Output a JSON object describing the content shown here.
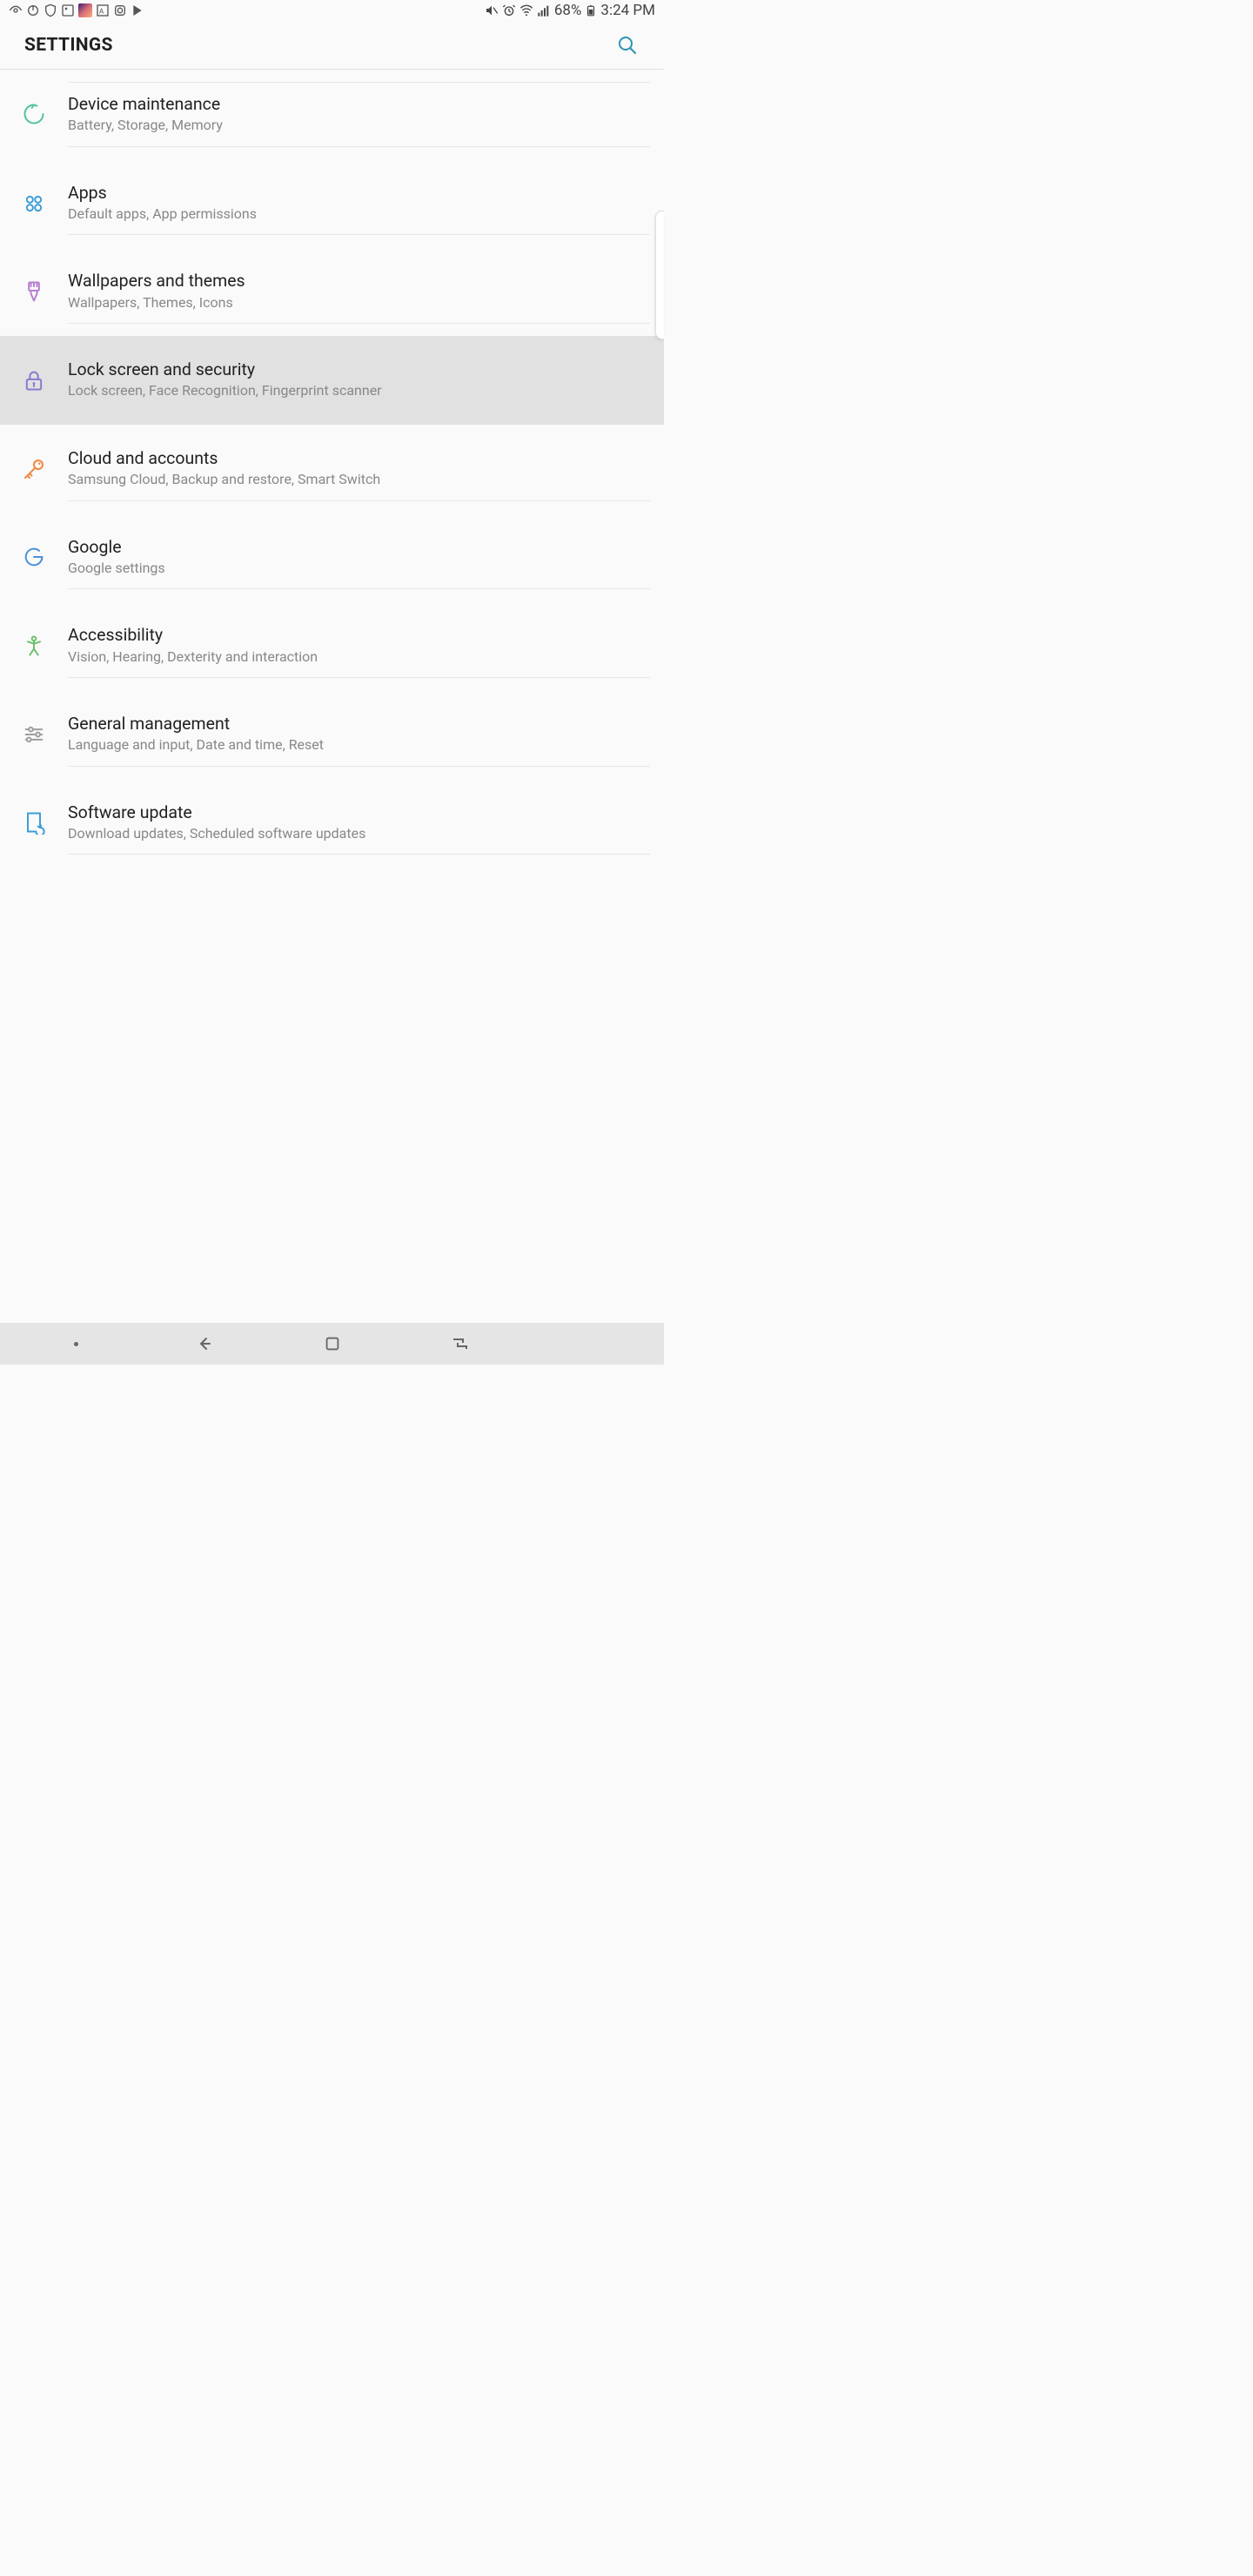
{
  "status": {
    "battery_pct": "68%",
    "time": "3:24 PM"
  },
  "header": {
    "title": "SETTINGS"
  },
  "items": [
    {
      "id": "device-maintenance",
      "title": "Device maintenance",
      "subtitle": "Battery, Storage, Memory",
      "icon": "refresh-circle",
      "color": "#4fc3a1",
      "selected": false
    },
    {
      "id": "apps",
      "title": "Apps",
      "subtitle": "Default apps, App permissions",
      "icon": "four-dots",
      "color": "#3b9fd6",
      "selected": false
    },
    {
      "id": "wallpapers-themes",
      "title": "Wallpapers and themes",
      "subtitle": "Wallpapers, Themes, Icons",
      "icon": "brush",
      "color": "#b77fcf",
      "selected": false
    },
    {
      "id": "lock-screen-security",
      "title": "Lock screen and security",
      "subtitle": "Lock screen, Face Recognition, Fingerprint scanner",
      "icon": "lock",
      "color": "#8a7bd0",
      "selected": true
    },
    {
      "id": "cloud-accounts",
      "title": "Cloud and accounts",
      "subtitle": "Samsung Cloud, Backup and restore, Smart Switch",
      "icon": "key",
      "color": "#f08c48",
      "selected": false
    },
    {
      "id": "google",
      "title": "Google",
      "subtitle": "Google settings",
      "icon": "google-g",
      "color": "#4a90d9",
      "selected": false
    },
    {
      "id": "accessibility",
      "title": "Accessibility",
      "subtitle": "Vision, Hearing, Dexterity and interaction",
      "icon": "person",
      "color": "#6cc06c",
      "selected": false
    },
    {
      "id": "general-management",
      "title": "General management",
      "subtitle": "Language and input, Date and time, Reset",
      "icon": "sliders",
      "color": "#9e9e9e",
      "selected": false
    },
    {
      "id": "software-update",
      "title": "Software update",
      "subtitle": "Download updates, Scheduled software updates",
      "icon": "update-arrow",
      "color": "#3b9fd6",
      "selected": false
    }
  ]
}
